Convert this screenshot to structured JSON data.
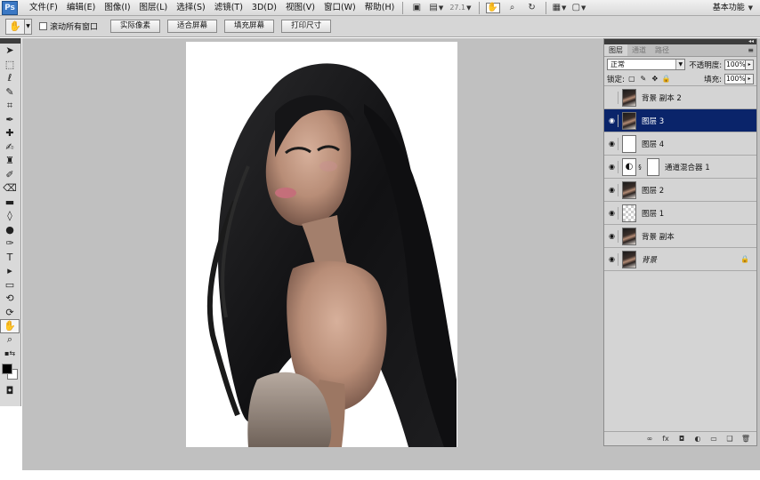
{
  "app": {
    "logo": "Ps",
    "menus": [
      "文件(F)",
      "编辑(E)",
      "图像(I)",
      "图层(L)",
      "选择(S)",
      "滤镜(T)",
      "3D(D)",
      "视图(V)",
      "窗口(W)",
      "帮助(H)"
    ],
    "zoom": "27.1",
    "workspace": "基本功能"
  },
  "icons": {
    "hand": "✋",
    "zoom": "🔍",
    "rotate": "↻",
    "layout": "▦",
    "screen_mode": "▣"
  },
  "options": {
    "scroll_all_windows": "滚动所有窗口",
    "btn_actual_pixels": "实际像素",
    "btn_fit_screen": "适合屏幕",
    "btn_fill_screen": "填充屏幕",
    "btn_print_size": "打印尺寸"
  },
  "colors": {
    "foreground": "#000000",
    "background": "#ffffff",
    "selection": "#0a246a",
    "panel_bg": "#d4d4d4",
    "workspace_bg": "#c0c0c0"
  },
  "layers_panel": {
    "tabs": [
      "图层",
      "通道",
      "路径"
    ],
    "blend_mode": "正常",
    "opacity_label": "不透明度:",
    "opacity_value": "100%",
    "lock_label": "锁定:",
    "fill_label": "填充:",
    "fill_value": "100%",
    "layers": [
      {
        "name": "背景 副本 2",
        "visible": false,
        "thumb": "photo",
        "selected": false
      },
      {
        "name": "图层 3",
        "visible": true,
        "thumb": "photo",
        "selected": true
      },
      {
        "name": "图层 4",
        "visible": true,
        "thumb": "white",
        "selected": false
      },
      {
        "name": "通道混合器 1",
        "visible": true,
        "thumb": "adjust",
        "selected": false
      },
      {
        "name": "图层 2",
        "visible": true,
        "thumb": "photo",
        "selected": false
      },
      {
        "name": "图层 1",
        "visible": true,
        "thumb": "transparent",
        "selected": false
      },
      {
        "name": "背景 副本",
        "visible": true,
        "thumb": "photo",
        "selected": false
      },
      {
        "name": "背景",
        "visible": true,
        "thumb": "photo",
        "selected": false,
        "locked": true
      }
    ]
  }
}
